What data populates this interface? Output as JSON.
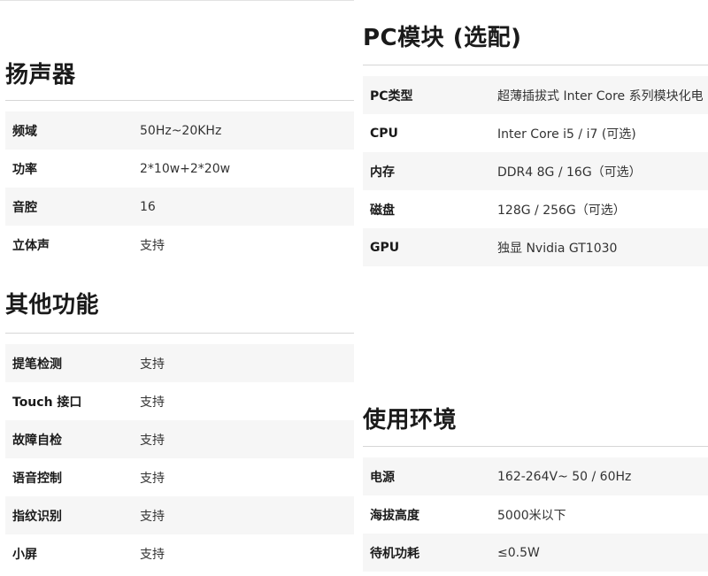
{
  "speaker": {
    "title": "扬声器",
    "rows": [
      {
        "label": "频域",
        "value": "50Hz~20KHz"
      },
      {
        "label": "功率",
        "value": "2*10w+2*20w"
      },
      {
        "label": "音腔",
        "value": "16"
      },
      {
        "label": "立体声",
        "value": "支持"
      }
    ]
  },
  "other": {
    "title": "其他功能",
    "rows": [
      {
        "label": "提笔检测",
        "value": "支持"
      },
      {
        "label": "Touch 接口",
        "value": "支持"
      },
      {
        "label": "故障自检",
        "value": "支持"
      },
      {
        "label": "语音控制",
        "value": "支持"
      },
      {
        "label": "指纹识别",
        "value": "支持"
      },
      {
        "label": "小屏",
        "value": "支持"
      }
    ]
  },
  "pc": {
    "title": "PC模块 (选配)",
    "rows": [
      {
        "label": "PC类型",
        "value": "超薄插拔式 Inter Core 系列模块化电"
      },
      {
        "label": "CPU",
        "value": "Inter Core i5 / i7 (可选)"
      },
      {
        "label": "内存",
        "value": "DDR4 8G / 16G（可选）"
      },
      {
        "label": "磁盘",
        "value": "128G / 256G（可选）"
      },
      {
        "label": "GPU",
        "value": "独显 Nvidia GT1030"
      }
    ]
  },
  "env": {
    "title": "使用环境",
    "rows": [
      {
        "label": "电源",
        "value": "162-264V~ 50 / 60Hz"
      },
      {
        "label": "海拔高度",
        "value": "5000米以下"
      },
      {
        "label": "待机功耗",
        "value": "≤0.5W"
      }
    ]
  }
}
